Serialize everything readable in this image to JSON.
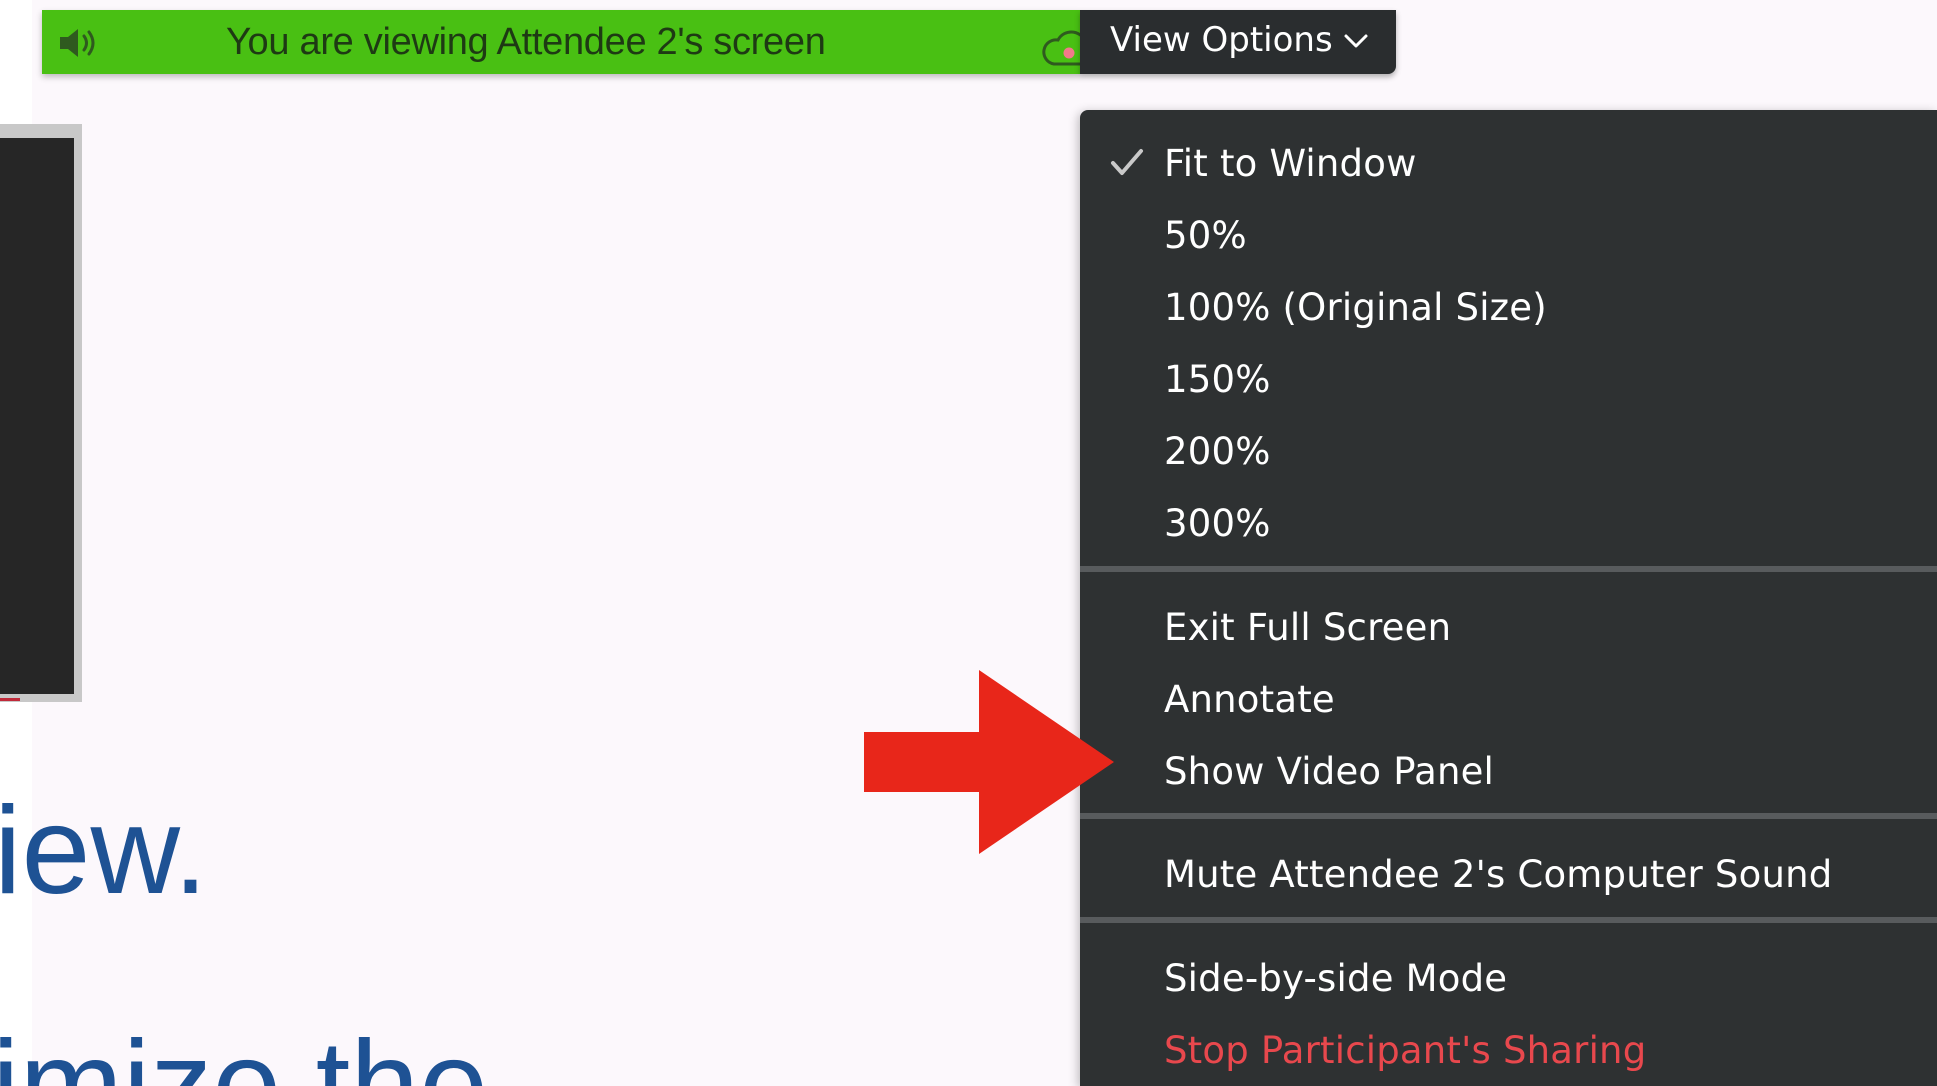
{
  "banner": {
    "text": "You are viewing Attendee 2's screen",
    "background_color": "#49c013",
    "speaker_icon": "speaker-icon",
    "record_icon": "cloud-record-icon"
  },
  "view_options": {
    "label": "View Options",
    "chevron_icon": "chevron-down-icon"
  },
  "slide": {
    "line1": "iew.",
    "line2": "imize the",
    "text_color": "#1e5294"
  },
  "annotation": {
    "arrow_color": "#e8261a",
    "arrow_icon": "arrow-right-icon"
  },
  "menu": {
    "groups": [
      {
        "items": [
          {
            "label": "Fit to Window",
            "checked": true
          },
          {
            "label": "50%",
            "checked": false
          },
          {
            "label": "100% (Original Size)",
            "checked": false
          },
          {
            "label": "150%",
            "checked": false
          },
          {
            "label": "200%",
            "checked": false
          },
          {
            "label": "300%",
            "checked": false
          }
        ]
      },
      {
        "items": [
          {
            "label": "Exit Full Screen"
          },
          {
            "label": "Annotate"
          },
          {
            "label": "Show Video Panel"
          }
        ]
      },
      {
        "items": [
          {
            "label": "Mute Attendee 2's Computer Sound"
          }
        ]
      },
      {
        "items": [
          {
            "label": "Side-by-side Mode"
          },
          {
            "label": "Stop Participant's Sharing",
            "danger": true
          }
        ]
      }
    ],
    "background_color": "#2e3132",
    "danger_color": "#e8484d"
  }
}
